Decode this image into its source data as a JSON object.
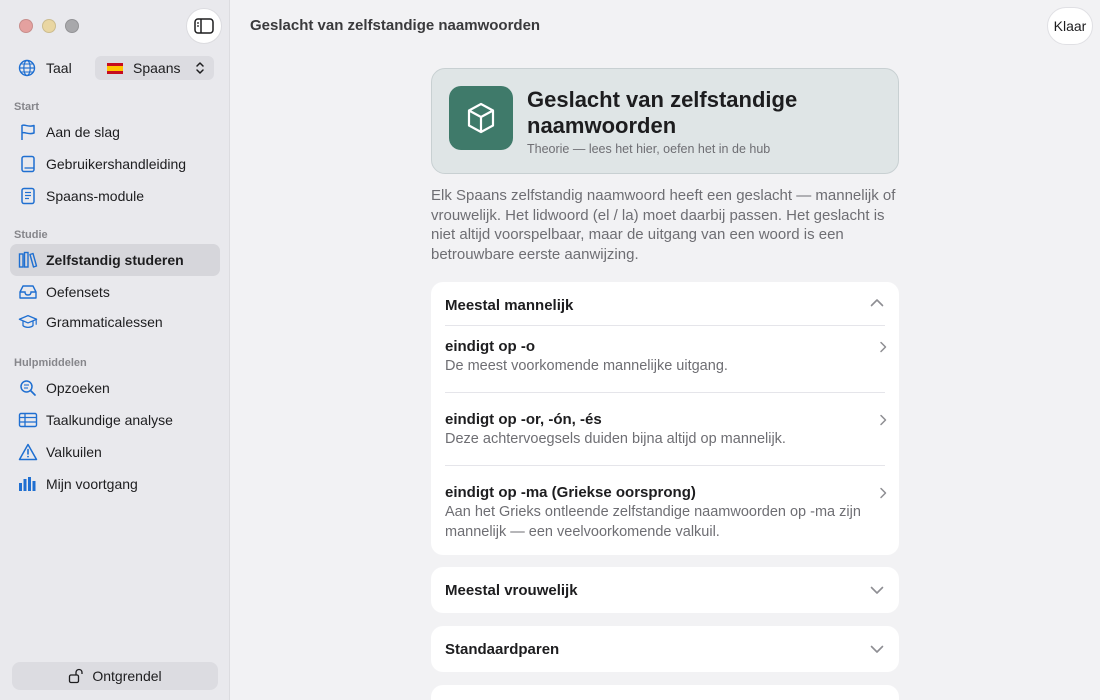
{
  "window": {
    "title": "Geslacht van zelfstandige naamwoorden",
    "done_label": "Klaar"
  },
  "colors": {
    "accent": "#1f6fd1",
    "hero_icon_bg": "#3f7a6a",
    "hero_bg": "#dfe5e6"
  },
  "sidebar": {
    "language_label": "Taal",
    "language_value": "Spaans",
    "sections": [
      {
        "header": "Start",
        "items": [
          {
            "label": "Aan de slag",
            "icon": "flag-icon"
          },
          {
            "label": "Gebruikershandleiding",
            "icon": "book-icon"
          },
          {
            "label": "Spaans-module",
            "icon": "notebook-icon"
          }
        ]
      },
      {
        "header": "Studie",
        "items": [
          {
            "label": "Zelfstandig studeren",
            "icon": "books-icon",
            "active": true
          },
          {
            "label": "Oefensets",
            "icon": "tray-icon"
          },
          {
            "label": "Grammaticalessen",
            "icon": "graduation-cap-icon"
          }
        ]
      },
      {
        "header": "Hulpmiddelen",
        "items": [
          {
            "label": "Opzoeken",
            "icon": "magnifier-icon"
          },
          {
            "label": "Taalkundige analyse",
            "icon": "table-icon"
          },
          {
            "label": "Valkuilen",
            "icon": "warning-icon"
          },
          {
            "label": "Mijn voortgang",
            "icon": "bar-chart-icon"
          }
        ]
      }
    ],
    "unlock_label": "Ontgrendel"
  },
  "hero": {
    "title": "Geslacht van zelfstandige naamwoorden",
    "subtitle": "Theorie — lees het hier, oefen het in de hub"
  },
  "intro": "Elk Spaans zelfstandig naamwoord heeft een geslacht — mannelijk of vrouwelijk. Het lidwoord (el / la) moet daarbij passen. Het geslacht is niet altijd voorspelbaar, maar de uitgang van een woord is een betrouwbare eerste aanwijzing.",
  "sections": [
    {
      "title": "Meestal mannelijk",
      "expanded": true,
      "rows": [
        {
          "title": "eindigt op -o",
          "desc": "De meest voorkomende mannelijke uitgang."
        },
        {
          "title": "eindigt op -or, -ón, -és",
          "desc": "Deze achtervoegsels duiden bijna altijd op mannelijk."
        },
        {
          "title": "eindigt op -ma (Griekse oorsprong)",
          "desc": "Aan het Grieks ontleende zelfstandige naamwoorden op -ma zijn mannelijk — een veelvoorkomende valkuil."
        }
      ]
    },
    {
      "title": "Meestal vrouwelijk",
      "expanded": false
    },
    {
      "title": "Standaardparen",
      "expanded": false
    }
  ]
}
